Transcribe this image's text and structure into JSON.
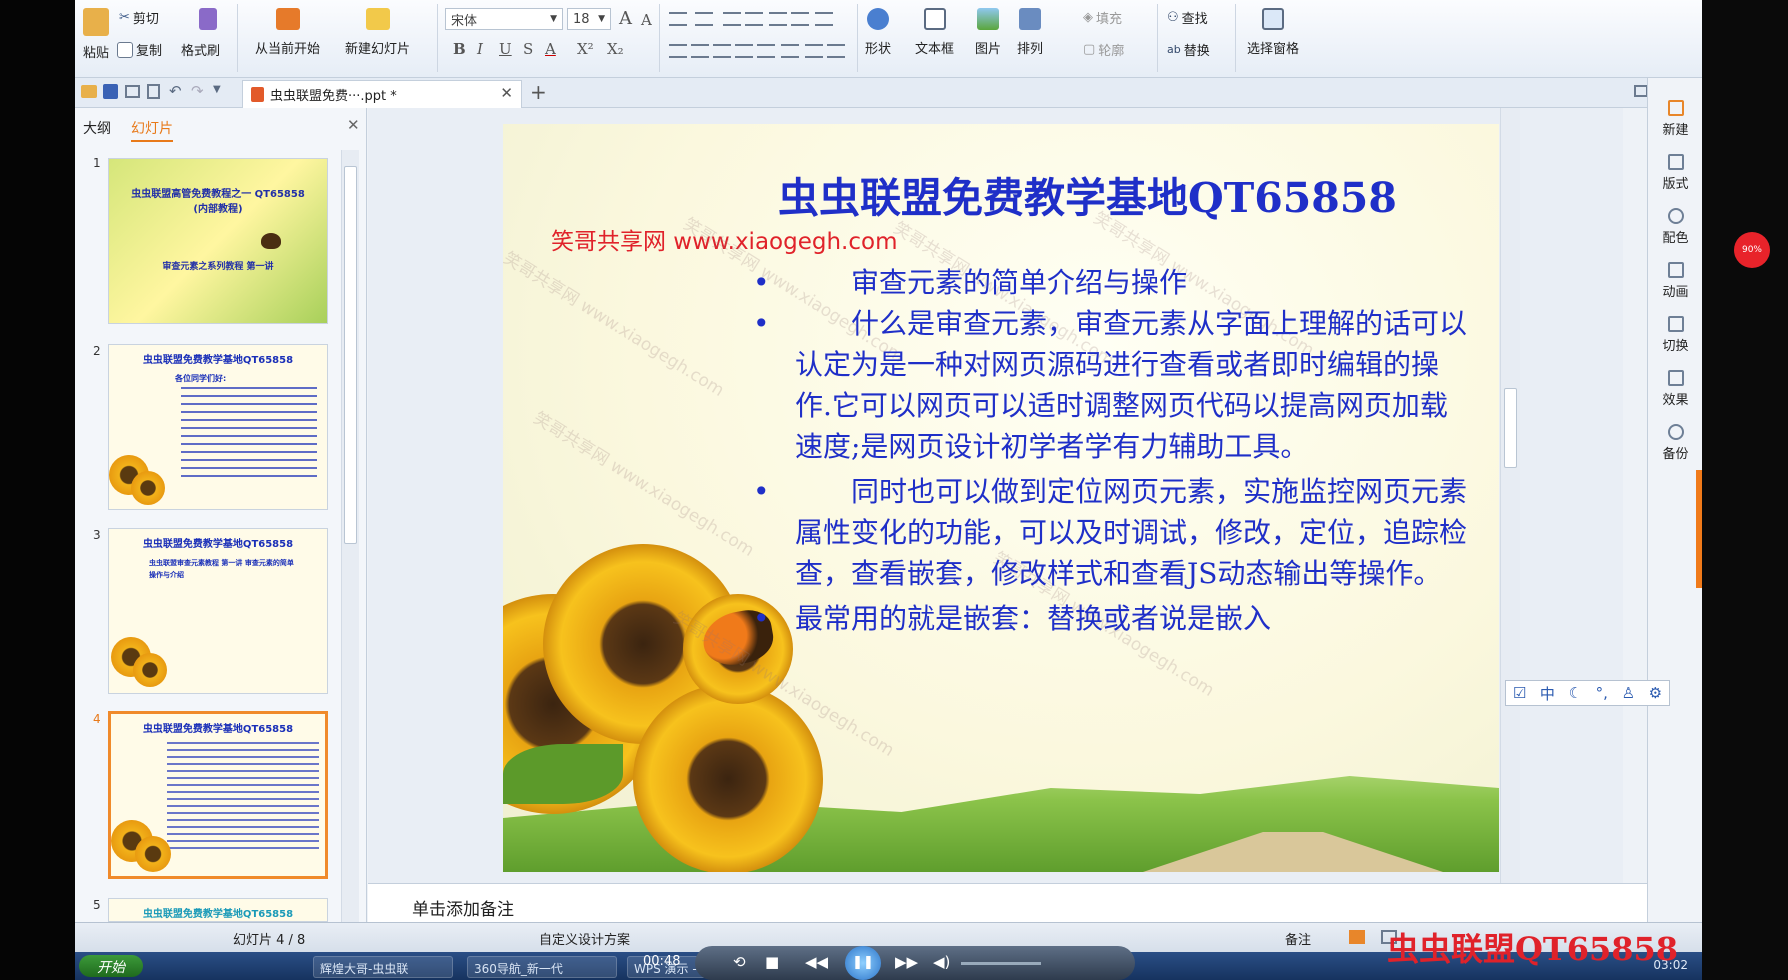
{
  "ribbon": {
    "paste": "粘贴",
    "cut": "剪切",
    "copy": "复制",
    "format_painter": "格式刷",
    "from_current": "从当前开始",
    "new_slide": "新建幻灯片",
    "font_name": "宋体",
    "font_size": "18",
    "shape": "形状",
    "textbox": "文本框",
    "picture": "图片",
    "arrange": "排列",
    "fill": "填充",
    "outline": "轮廓",
    "find": "查找",
    "replace": "替换",
    "selection_pane": "选择窗格"
  },
  "tabs": {
    "file_tab": "虫虫联盟免费···.ppt *"
  },
  "left_panel": {
    "tab_outline": "大纲",
    "tab_slides": "幻灯片",
    "thumbs": [
      {
        "num": "1",
        "title": "虫虫联盟高管免费教程之一 QT65858 (内部教程)",
        "sub": "审查元素之系列教程 第一讲"
      },
      {
        "num": "2",
        "title": "虫虫联盟免费教学基地QT65858",
        "sub": "各位同学们好:"
      },
      {
        "num": "3",
        "title": "虫虫联盟免费教学基地QT65858",
        "sub": "虫虫联盟审查元素教程 第一讲 审查元素的简单操作与介绍"
      },
      {
        "num": "4",
        "title": "虫虫联盟免费教学基地QT65858",
        "sub": ""
      },
      {
        "num": "5",
        "title": "虫虫联盟免费教学基地QT65858",
        "sub": ""
      }
    ]
  },
  "slide": {
    "title": "虫虫联盟免费教学基地QT65858",
    "watermark": "笑哥共享网  www.xiaogegh.com",
    "diag_watermark": "笑哥共享网 www.xiaogegh.com",
    "bullets": [
      {
        "dot": "•",
        "text": "审查元素的简单介绍与操作"
      },
      {
        "dot": "•",
        "text": "什么是审查元素，审查元素从字面上理解的话可以认定为是一种对网页源码进行查看或者即时编辑的操作.它可以网页可以适时调整网页代码以提高网页加载速度;是网页设计初学者学有力辅助工具。"
      },
      {
        "dot": "•",
        "text": "同时也可以做到定位网页元素，实施监控网页元素属性变化的功能，可以及时调试，修改，定位，追踪检查，查看嵌套，修改样式和查看JS动态输出等操作。"
      },
      {
        "dot": "•",
        "text": "最常用的就是嵌套：替换或者说是嵌入"
      }
    ]
  },
  "right_sidebar": [
    "新建",
    "版式",
    "配色",
    "动画",
    "切换",
    "效果",
    "备份"
  ],
  "notes_placeholder": "单击添加备注",
  "status": {
    "slide_counter": "幻灯片 4 / 8",
    "design": "自定义设计方案",
    "notes_btn": "备注"
  },
  "overlay": {
    "brand": "虫虫联盟QT65858",
    "time": "00:48",
    "clock": "03:02",
    "percent": "90%"
  },
  "taskbar": {
    "start": "开始",
    "items": [
      "辉煌大哥-虫虫联",
      "360导航_新一代",
      "WPS 演示 - [虫"
    ]
  },
  "colors": {
    "title_blue": "#1f2fc8",
    "watermark_red": "#e0222a",
    "selected_orange": "#f08a2a"
  }
}
